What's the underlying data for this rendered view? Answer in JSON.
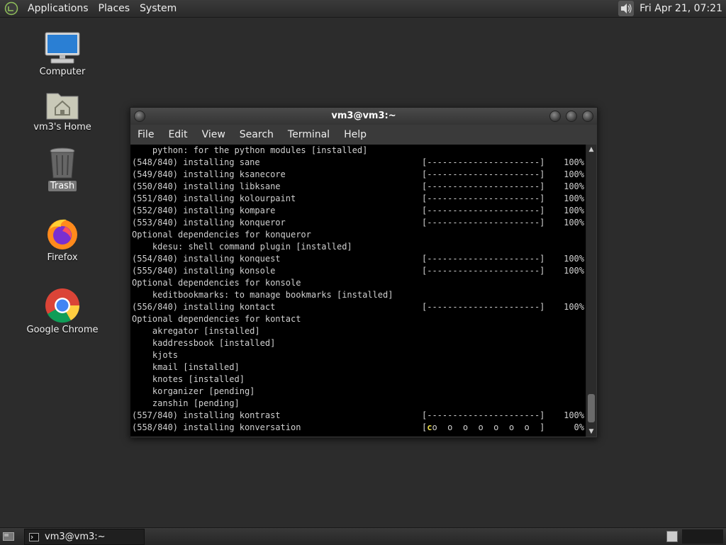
{
  "top_panel": {
    "menus": [
      "Applications",
      "Places",
      "System"
    ],
    "clock": "Fri Apr 21, 07:21"
  },
  "desktop": {
    "icons": [
      {
        "label": "Computer",
        "icon": "computer-icon"
      },
      {
        "label": "vm3's Home",
        "icon": "home-folder-icon"
      },
      {
        "label": "Trash",
        "icon": "trash-icon"
      },
      {
        "label": "Firefox",
        "icon": "firefox-icon"
      },
      {
        "label": "Google Chrome",
        "icon": "chrome-icon"
      }
    ]
  },
  "window": {
    "title": "vm3@vm3:~",
    "menu": [
      "File",
      "Edit",
      "View",
      "Search",
      "Terminal",
      "Help"
    ]
  },
  "terminal": {
    "lines": [
      {
        "text": "    python: for the python modules [installed]"
      },
      {
        "text": "(548/840) installing sane",
        "bar": "[----------------------]",
        "pct": "100%"
      },
      {
        "text": "(549/840) installing ksanecore",
        "bar": "[----------------------]",
        "pct": "100%"
      },
      {
        "text": "(550/840) installing libksane",
        "bar": "[----------------------]",
        "pct": "100%"
      },
      {
        "text": "(551/840) installing kolourpaint",
        "bar": "[----------------------]",
        "pct": "100%"
      },
      {
        "text": "(552/840) installing kompare",
        "bar": "[----------------------]",
        "pct": "100%"
      },
      {
        "text": "(553/840) installing konqueror",
        "bar": "[----------------------]",
        "pct": "100%"
      },
      {
        "text": "Optional dependencies for konqueror"
      },
      {
        "text": "    kdesu: shell command plugin [installed]"
      },
      {
        "text": "(554/840) installing konquest",
        "bar": "[----------------------]",
        "pct": "100%"
      },
      {
        "text": "(555/840) installing konsole",
        "bar": "[----------------------]",
        "pct": "100%"
      },
      {
        "text": "Optional dependencies for konsole"
      },
      {
        "text": "    keditbookmarks: to manage bookmarks [installed]"
      },
      {
        "text": "(556/840) installing kontact",
        "bar": "[----------------------]",
        "pct": "100%"
      },
      {
        "text": "Optional dependencies for kontact"
      },
      {
        "text": "    akregator [installed]"
      },
      {
        "text": "    kaddressbook [installed]"
      },
      {
        "text": "    kjots"
      },
      {
        "text": "    kmail [installed]"
      },
      {
        "text": "    knotes [installed]"
      },
      {
        "text": "    korganizer [pending]"
      },
      {
        "text": "    zanshin [pending]"
      },
      {
        "text": "(557/840) installing kontrast",
        "bar": "[----------------------]",
        "pct": "100%"
      },
      {
        "text": "(558/840) installing konversation",
        "bar_open": "[",
        "pacman": "c",
        "bar_rest": "o  o  o  o  o  o  o  ]",
        "pct": "0%"
      }
    ]
  },
  "taskbar": {
    "task_label": "vm3@vm3:~"
  }
}
